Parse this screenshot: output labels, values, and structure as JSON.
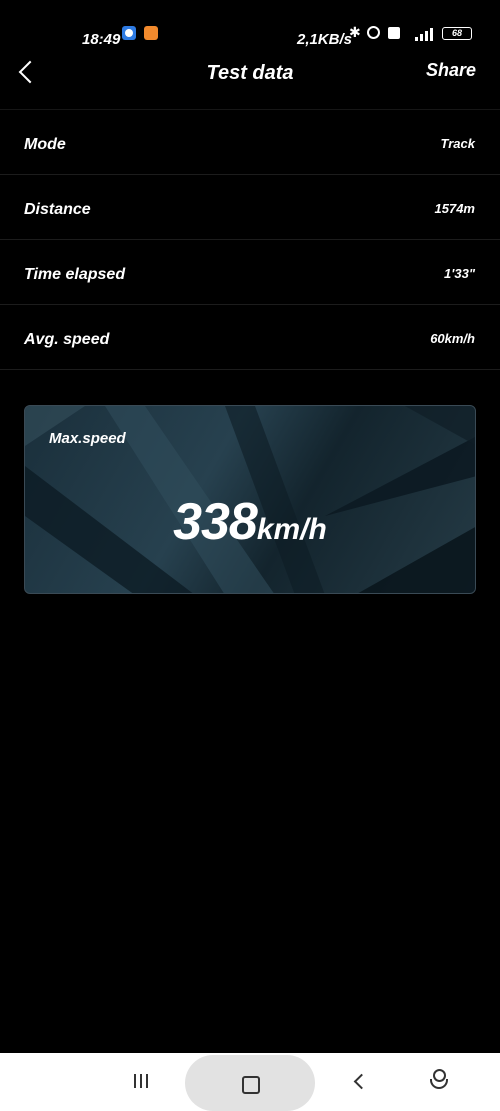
{
  "status_bar": {
    "time": "18:49",
    "net_speed": "2,1KB/s",
    "battery": "68",
    "icons": [
      "phone-app-icon",
      "notification-app-icon",
      "bluetooth-icon",
      "alarm-icon",
      "volte-icon",
      "lte-signal-icon",
      "battery-icon"
    ]
  },
  "header": {
    "title": "Test data",
    "share_label": "Share"
  },
  "rows": [
    {
      "label": "Mode",
      "value": "Track"
    },
    {
      "label": "Distance",
      "value": "1574m"
    },
    {
      "label": "Time elapsed",
      "value": "1'33\""
    },
    {
      "label": "Avg. speed",
      "value": "60km/h"
    }
  ],
  "max_speed_card": {
    "caption": "Max.speed",
    "value": "338",
    "unit": "km/h"
  },
  "nav_bar": {
    "icons": [
      "menu-icon",
      "home-icon",
      "back-icon",
      "assistant-icon"
    ]
  },
  "colors": {
    "background": "#000000",
    "card": "#1f3542",
    "nav_bar": "#ffffff"
  }
}
